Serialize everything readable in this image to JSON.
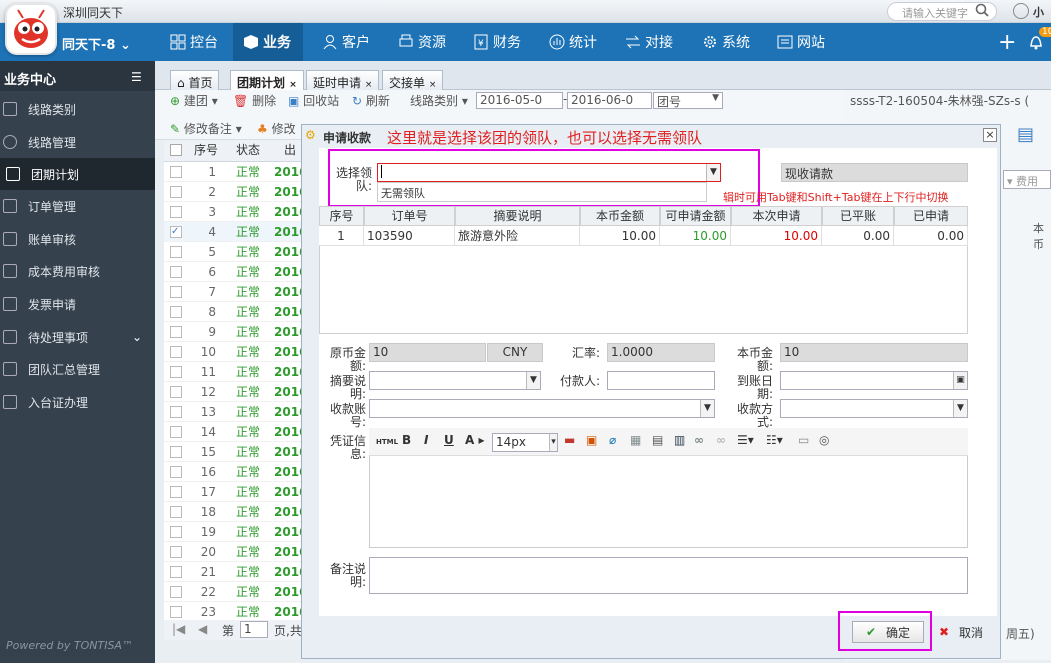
{
  "top": {
    "company": "深圳同天下",
    "search_placeholder": "请输入关键字",
    "user": "小"
  },
  "nav": {
    "user_menu": "同天下-8",
    "items": [
      "控台",
      "业务",
      "客户",
      "资源",
      "财务",
      "统计",
      "对接",
      "系统",
      "网站"
    ],
    "active": "业务",
    "badge": "10"
  },
  "sidebar": {
    "title": "业务中心",
    "items": [
      "线路类别",
      "线路管理",
      "团期计划",
      "订单管理",
      "账单审核",
      "成本费用审核",
      "发票申请",
      "待处理事项",
      "团队汇总管理",
      "入台证办理"
    ],
    "active": "团期计划",
    "powered": "Powered by TONTISA™"
  },
  "tabs": [
    "首页",
    "团期计划",
    "延时申请",
    "交接单"
  ],
  "toolbar1": {
    "build": "建团",
    "delete": "删除",
    "recycle": "回收站",
    "refresh": "刷新",
    "route_type": "线路类别",
    "date_from": "2016-05-0",
    "date_to": "2016-06-0",
    "tour_no": "团号"
  },
  "toolbar2": {
    "edit_note": "修改备注",
    "edit": "修改"
  },
  "grid": {
    "cols": [
      "序号",
      "状态",
      "出"
    ],
    "rows": [
      [
        "1",
        "正常",
        "2016"
      ],
      [
        "2",
        "正常",
        "2016"
      ],
      [
        "3",
        "正常",
        "2016"
      ],
      [
        "4",
        "正常",
        "2016"
      ],
      [
        "5",
        "正常",
        "2016"
      ],
      [
        "6",
        "正常",
        "2016"
      ],
      [
        "7",
        "正常",
        "2016"
      ],
      [
        "8",
        "正常",
        "2016"
      ],
      [
        "9",
        "正常",
        "2016"
      ],
      [
        "10",
        "正常",
        "2016"
      ],
      [
        "11",
        "正常",
        "2016"
      ],
      [
        "12",
        "正常",
        "2016"
      ],
      [
        "13",
        "正常",
        "2016"
      ],
      [
        "14",
        "正常",
        "2016"
      ],
      [
        "15",
        "正常",
        "2016"
      ],
      [
        "16",
        "正常",
        "2016"
      ],
      [
        "17",
        "正常",
        "2016"
      ],
      [
        "18",
        "正常",
        "2016"
      ],
      [
        "19",
        "正常",
        "2016"
      ],
      [
        "20",
        "正常",
        "2016"
      ],
      [
        "21",
        "正常",
        "2016"
      ],
      [
        "22",
        "正常",
        "2016"
      ],
      [
        "23",
        "正常",
        "2016"
      ]
    ],
    "pager_page": "第",
    "pager_num": "1",
    "pager_of": "页,共"
  },
  "right": {
    "header": "ssss-T2-160504-朱林强-SZs-s (",
    "fee": "费用",
    "col": "本币",
    "week": "周五)"
  },
  "dialog": {
    "title": "申请收款",
    "annotation": "这里就是选择该团的领队，也可以选择无需领队",
    "leader_label": "选择领队:",
    "leader_option": "无需领队",
    "pay_type": "现收请款",
    "hint": "辑时可用Tab键和Shift+Tab键在上下行中切换",
    "table": {
      "cols": [
        "序号",
        "订单号",
        "摘要说明",
        "本币金额",
        "可申请金额",
        "本次申请",
        "已平账",
        "已申请"
      ],
      "rows": [
        [
          "1",
          "103590",
          "旅游意外险",
          "10.00",
          "10.00",
          "10.00",
          "0.00",
          "0.00"
        ]
      ]
    },
    "orig_amt_label": "原币金额:",
    "orig_amt": "10",
    "currency": "CNY",
    "rate_label": "汇率:",
    "rate": "1.0000",
    "base_amt_label": "本币金额:",
    "base_amt": "10",
    "summary_label": "摘要说明:",
    "payer_label": "付款人:",
    "arrive_label": "到账日期:",
    "account_label": "收款账号:",
    "method_label": "收款方式:",
    "voucher_label": "凭证信息:",
    "font_size": "14px",
    "remark_label": "备注说明:",
    "ok": "确定",
    "cancel": "取消"
  },
  "colors": {
    "nav": "#1d73b6",
    "sidebar": "#35414d",
    "highlight": "#e000e0",
    "annotation": "#e02020",
    "green": "#2e9b2e",
    "red": "#e00000"
  }
}
